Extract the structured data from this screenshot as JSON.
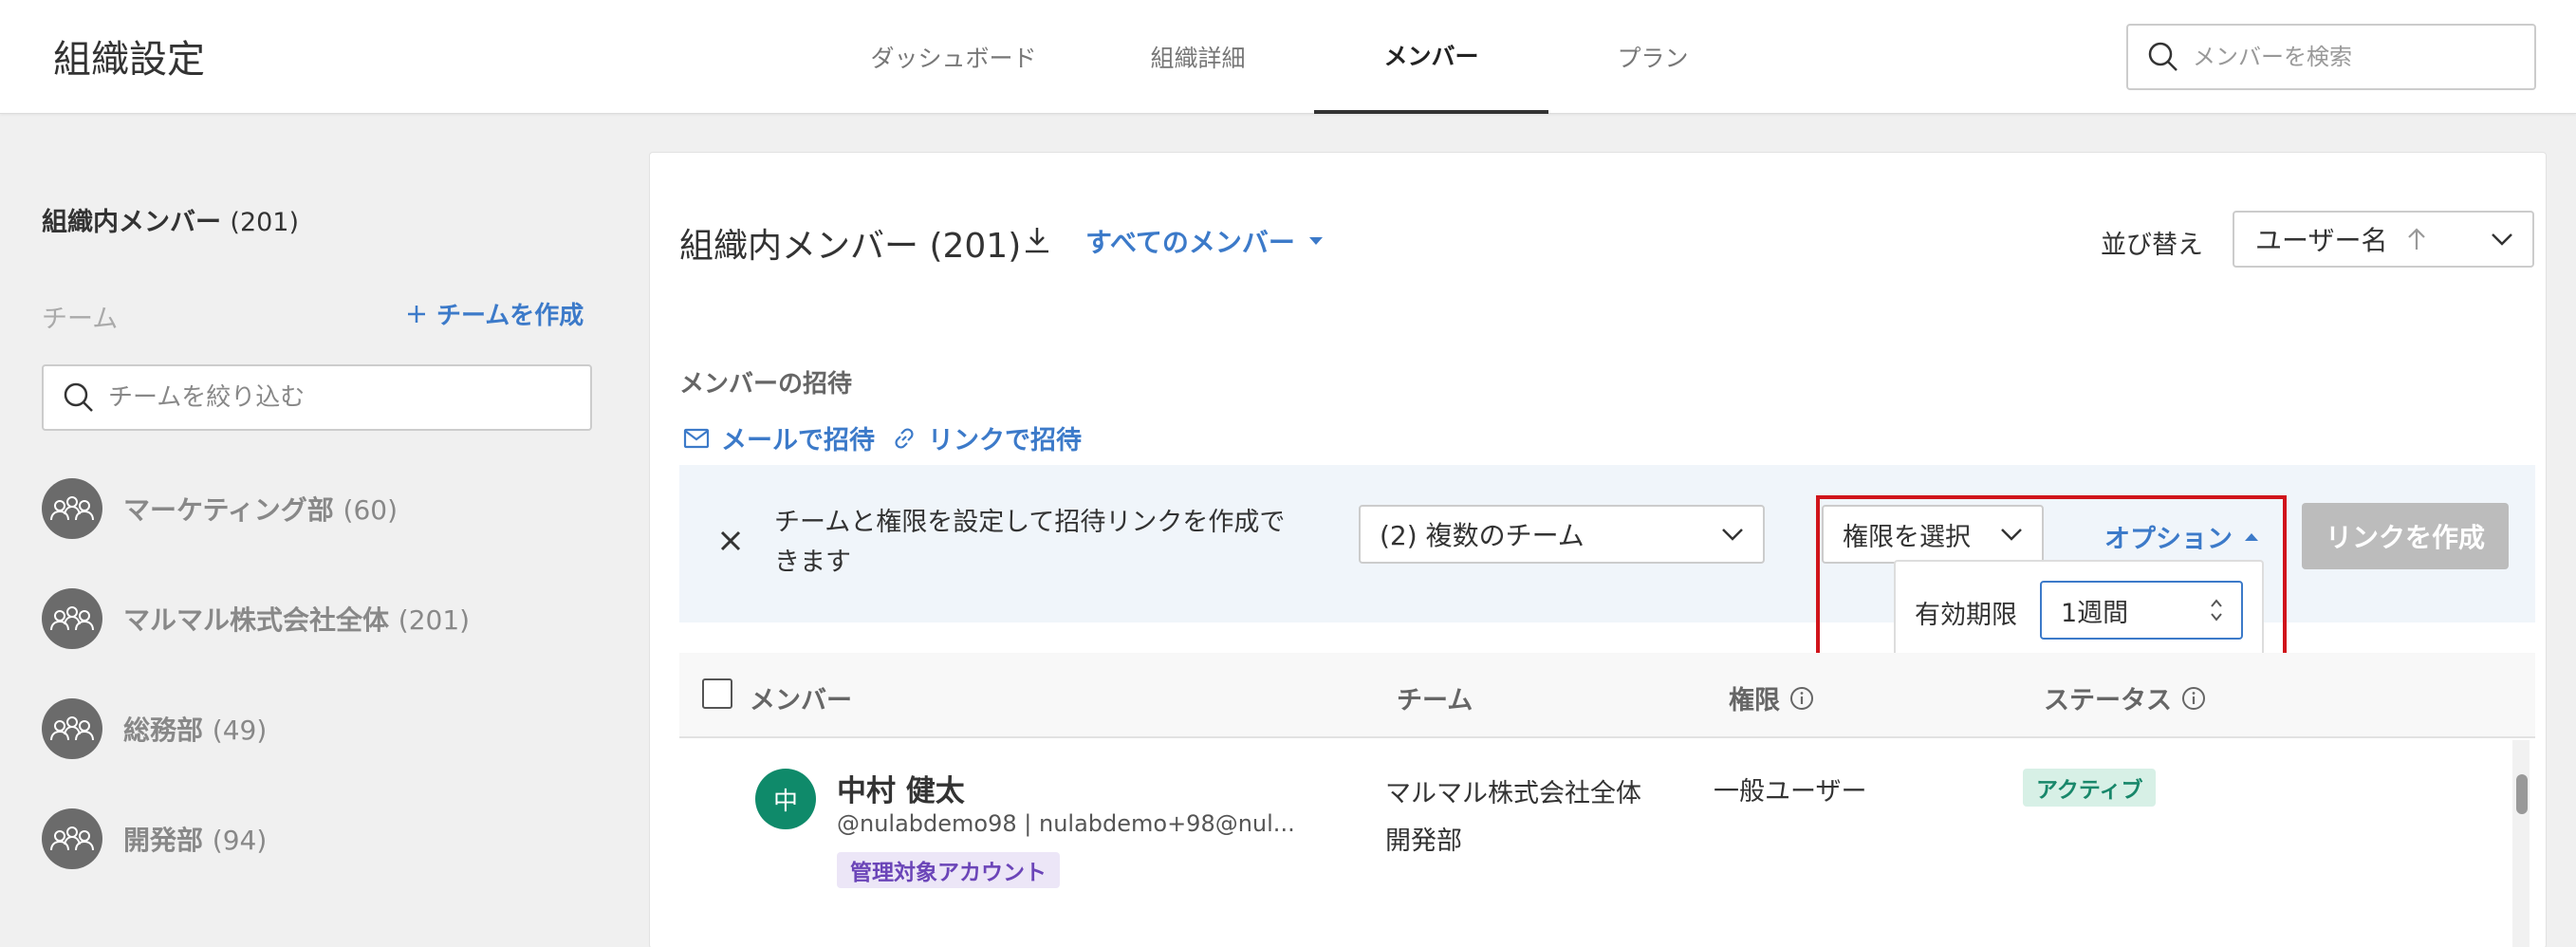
{
  "header": {
    "title": "組織設定",
    "tabs": [
      "ダッシュボード",
      "組織詳細",
      "メンバー",
      "プラン"
    ],
    "active_tab": "メンバー",
    "search_placeholder": "メンバーを検索"
  },
  "sidebar": {
    "heading": "組織内メンバー",
    "heading_count": "(201)",
    "teams_label": "チーム",
    "create_team_label": "チームを作成",
    "filter_placeholder": "チームを絞り込む",
    "teams": [
      {
        "name": "マーケティング部",
        "count": "(60)"
      },
      {
        "name": "マルマル株式会社全体",
        "count": "(201)"
      },
      {
        "name": "総務部",
        "count": "(49)"
      },
      {
        "name": "開発部",
        "count": "(94)"
      }
    ]
  },
  "main": {
    "title": "組織内メンバー (201)",
    "filter_label": "すべてのメンバー",
    "sort_label": "並び替え",
    "sort_value": "ユーザー名",
    "invite": {
      "heading": "メンバーの招待",
      "email_label": "メールで招待",
      "link_label": "リンクで招待",
      "description": "チームと権限を設定して招待リンクを作成できます",
      "team_select_value": "(2) 複数のチーム",
      "permission_placeholder": "権限を選択",
      "options_label": "オプション",
      "create_link_label": "リンクを作成",
      "expiry_label": "有効期限",
      "expiry_value": "1週間"
    },
    "table": {
      "columns": [
        "メンバー",
        "チーム",
        "権限",
        "ステータス"
      ],
      "rows": [
        {
          "avatar": "中",
          "name": "中村 健太",
          "sub": "@nulabdemo98 | nulabdemo+98@nul...",
          "badge": "管理対象アカウント",
          "teams": [
            "マルマル株式会社全体",
            "開発部"
          ],
          "permission": "一般ユーザー",
          "status": "アクティブ"
        }
      ]
    }
  },
  "colors": {
    "accent": "#3c7ac9",
    "highlight_box": "#d0141b",
    "active_status": "#18876a",
    "avatar": "#0f8a6a"
  }
}
